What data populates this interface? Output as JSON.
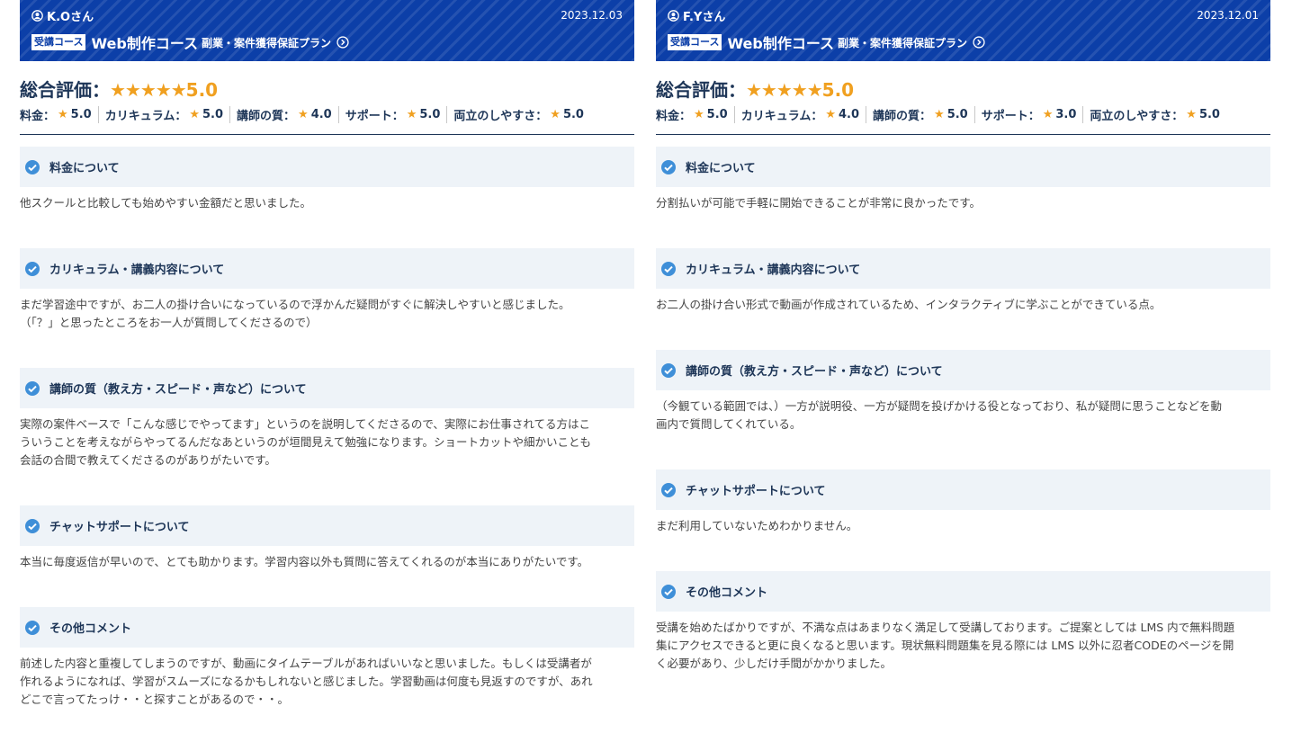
{
  "reviews": [
    {
      "user": "K.Oさん",
      "date": "2023.12.03",
      "course_badge": "受講コース",
      "course_name": "Web制作コース",
      "course_plan": "副業・案件獲得保証プラン",
      "overall_label": "総合評価：",
      "overall_stars": "★★★★★",
      "overall_score": "5.0",
      "subratings": [
        {
          "label": "料金：",
          "star": "★",
          "value": "5.0"
        },
        {
          "label": "カリキュラム：",
          "star": "★",
          "value": "5.0"
        },
        {
          "label": "講師の質：",
          "star": "★",
          "value": "4.0"
        },
        {
          "label": "サポート：",
          "star": "★",
          "value": "5.0"
        },
        {
          "label": "両立のしやすさ：",
          "star": "★",
          "value": "5.0"
        }
      ],
      "sections": [
        {
          "title": "料金について",
          "body": "他スクールと比較しても始めやすい金額だと思いました。"
        },
        {
          "title": "カリキュラム・講義内容について",
          "body": "まだ学習途中ですが、お二人の掛け合いになっているので浮かんだ疑問がすぐに解決しやすいと感じました。\n（「？」と思ったところをお一人が質問してくださるので）"
        },
        {
          "title": "講師の質（教え方・スピード・声など）について",
          "body": "実際の案件ベースで「こんな感じでやってます」というのを説明してくださるので、実際にお仕事されてる方はこ\nういうことを考えながらやってるんだなあというのが垣間見えて勉強になります。ショートカットや細かいことも\n会話の合間で教えてくださるのがありがたいです。"
        },
        {
          "title": "チャットサポートについて",
          "body": "本当に毎度返信が早いので、とても助かります。学習内容以外も質問に答えてくれるのが本当にありがたいです。"
        },
        {
          "title": "その他コメント",
          "body": "前述した内容と重複してしまうのですが、動画にタイムテーブルがあればいいなと思いました。もしくは受講者が\n作れるようになれば、学習がスムーズになるかもしれないと感じました。学習動画は何度も見返すのですが、あれ\nどこで言ってたっけ・・と探すことがあるので・・。"
        }
      ]
    },
    {
      "user": "F.Yさん",
      "date": "2023.12.01",
      "course_badge": "受講コース",
      "course_name": "Web制作コース",
      "course_plan": "副業・案件獲得保証プラン",
      "overall_label": "総合評価：",
      "overall_stars": "★★★★★",
      "overall_score": "5.0",
      "subratings": [
        {
          "label": "料金：",
          "star": "★",
          "value": "5.0"
        },
        {
          "label": "カリキュラム：",
          "star": "★",
          "value": "4.0"
        },
        {
          "label": "講師の質：",
          "star": "★",
          "value": "5.0"
        },
        {
          "label": "サポート：",
          "star": "★",
          "value": "3.0"
        },
        {
          "label": "両立のしやすさ：",
          "star": "★",
          "value": "5.0"
        }
      ],
      "sections": [
        {
          "title": "料金について",
          "body": "分割払いが可能で手軽に開始できることが非常に良かったです。"
        },
        {
          "title": "カリキュラム・講義内容について",
          "body": "お二人の掛け合い形式で動画が作成されているため、インタラクティブに学ぶことができている点。"
        },
        {
          "title": "講師の質（教え方・スピード・声など）について",
          "body": "（今観ている範囲では、）一方が説明役、一方が疑問を投げかける役となっており、私が疑問に思うことなどを動\n画内で質問してくれている。"
        },
        {
          "title": "チャットサポートについて",
          "body": "まだ利用していないためわかりません。"
        },
        {
          "title": "その他コメント",
          "body": "受講を始めたばかりですが、不満な点はあまりなく満足して受講しております。ご提案としては LMS 内で無料問題\n集にアクセスできると更に良くなると思います。現状無料問題集を見る際には LMS 以外に忍者CODEのページを開\nく必要があり、少しだけ手間がかかりました。"
        }
      ]
    }
  ]
}
